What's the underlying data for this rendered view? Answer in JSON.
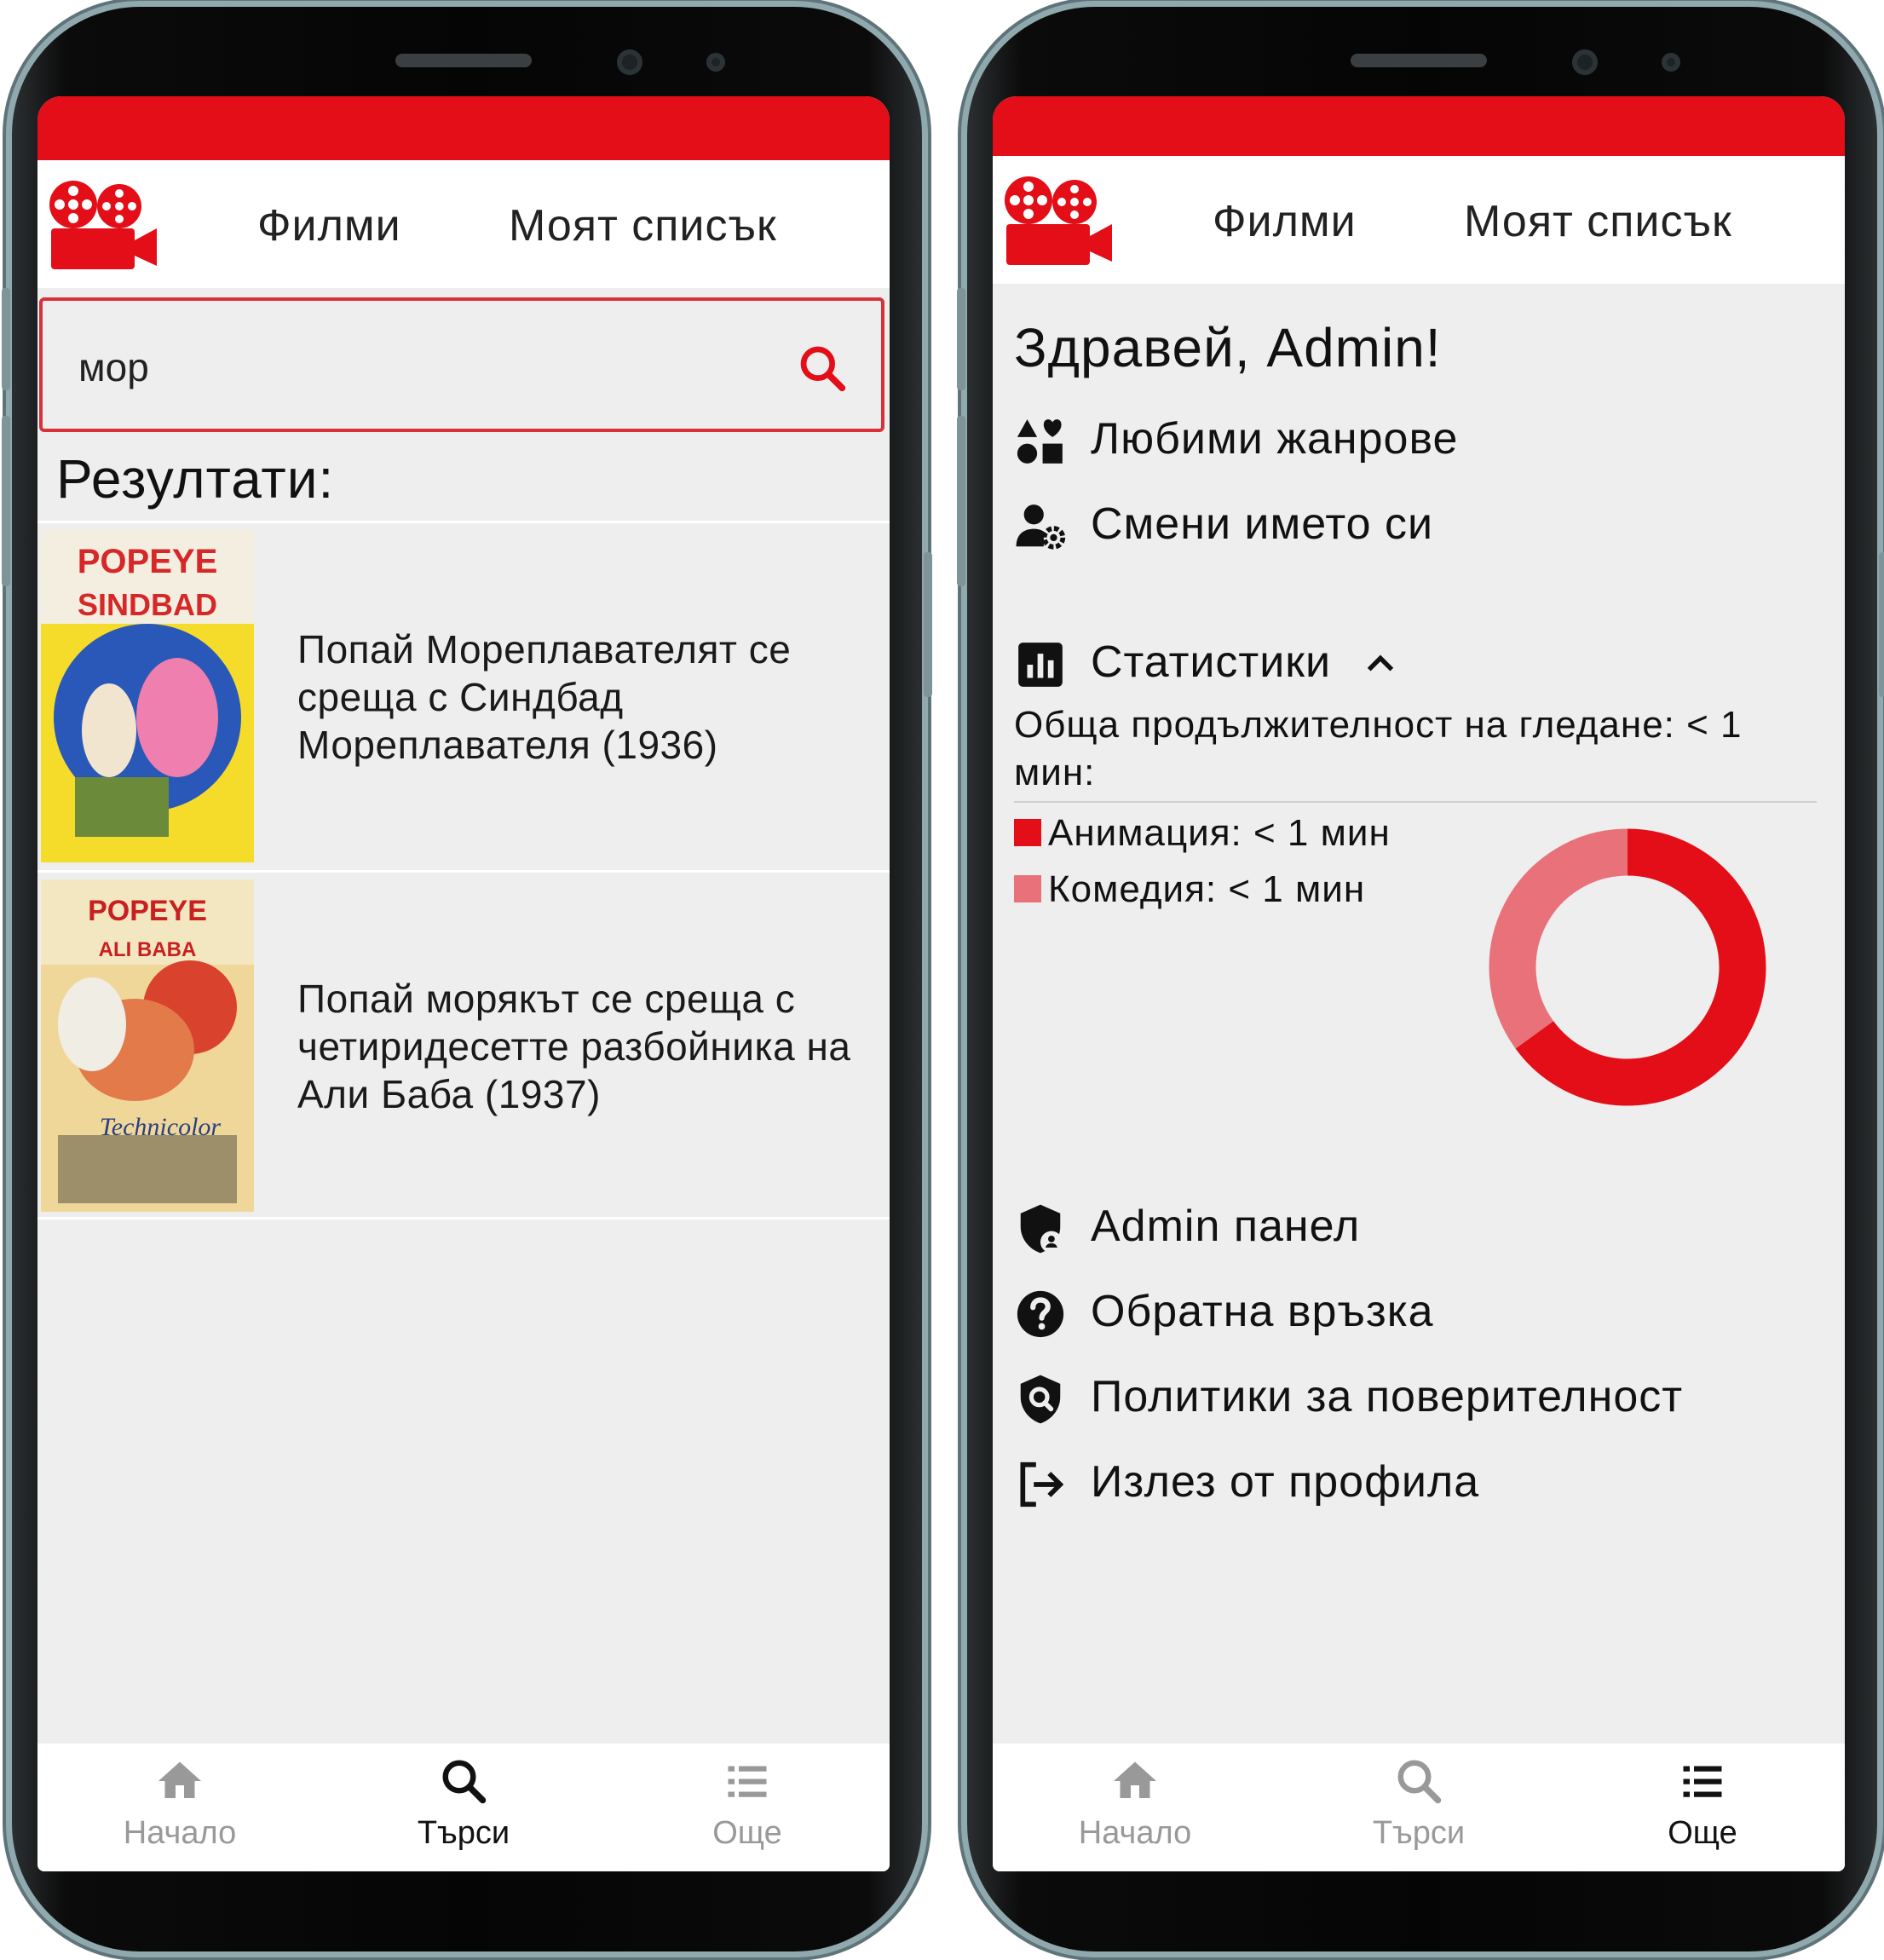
{
  "brand": {
    "primary": "#e30e17",
    "secondary": "#e9727a",
    "background": "#eeeeee"
  },
  "left_screen": {
    "nav": {
      "films": "Филми",
      "my_list": "Моят списък"
    },
    "search": {
      "value": "мор"
    },
    "results_title": "Резултати:",
    "results": [
      {
        "title": "Попай Мореплавателят се среща с Синдбад Мореплавателя (1936)",
        "poster": "poster-popeye-sindbad"
      },
      {
        "title": "Попай морякът се среща с четиридесетте разбойника на Али Баба (1937)",
        "poster": "poster-popeye-ali-baba"
      }
    ],
    "bottom_nav": {
      "home": "Начало",
      "search": "Търси",
      "more": "Още",
      "active": "search"
    }
  },
  "right_screen": {
    "nav": {
      "films": "Филми",
      "my_list": "Моят списък"
    },
    "greeting": "Здравей, Admin!",
    "menu_top": [
      {
        "label": "Любими жанрове",
        "icon": "shapes-heart-icon"
      },
      {
        "label": "Смени името си",
        "icon": "user-gear-icon"
      }
    ],
    "statistics": {
      "label": "Статистики",
      "icon": "bar-chart-icon",
      "expanded": true,
      "total": "Обща продължителност на гледане: < 1 мин:",
      "legend": [
        {
          "label": "Анимация: < 1 мин",
          "color": "#e30e17"
        },
        {
          "label": "Комедия: < 1 мин",
          "color": "#e9727a"
        }
      ]
    },
    "menu_bottom": [
      {
        "label": "Admin панел",
        "icon": "admin-shield-icon"
      },
      {
        "label": "Обратна връзка",
        "icon": "question-icon"
      },
      {
        "label": "Политики за поверителност",
        "icon": "privacy-shield-icon"
      },
      {
        "label": "Излез от профила",
        "icon": "logout-icon"
      }
    ],
    "bottom_nav": {
      "home": "Начало",
      "search": "Търси",
      "more": "Още",
      "active": "more"
    }
  },
  "chart_data": {
    "type": "pie",
    "categories": [
      "Анимация",
      "Комедия"
    ],
    "values": [
      0.65,
      0.35
    ],
    "colors": [
      "#e30e17",
      "#e9727a"
    ],
    "donut": true
  }
}
